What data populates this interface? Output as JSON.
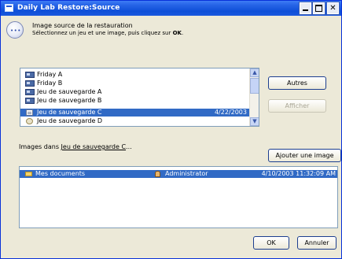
{
  "window": {
    "title": "Daily Lab Restore:Source"
  },
  "header": {
    "title": "Image source de la restauration",
    "subtitle_prefix": "Sélectionnez un jeu et une image, puis cliquez sur ",
    "subtitle_ok": "OK",
    "subtitle_suffix": "."
  },
  "source_list": {
    "items": [
      {
        "label": "Friday A",
        "date": "",
        "icon": "backup-set-icon",
        "selected": false
      },
      {
        "label": "Friday B",
        "date": "",
        "icon": "backup-set-icon",
        "selected": false
      },
      {
        "label": "Jeu de sauvegarde A",
        "date": "",
        "icon": "backup-set-icon",
        "selected": false
      },
      {
        "label": "Jeu de sauvegarde B",
        "date": "",
        "icon": "backup-set-icon",
        "selected": false
      },
      {
        "label": "Jeu de sauvegarde C",
        "date": "4/22/2003",
        "icon": "catalog-icon",
        "selected": true
      },
      {
        "label": "Jeu de sauvegarde D",
        "date": "",
        "icon": "tape-icon",
        "selected": false
      }
    ]
  },
  "buttons": {
    "autres": "Autres",
    "afficher": "Afficher",
    "ajouter": "Ajouter une image",
    "ok": "OK",
    "annuler": "Annuler"
  },
  "images": {
    "label_prefix": "Images dans ",
    "label_link": "Jeu de sauvegarde C",
    "label_suffix": "...",
    "rows": [
      {
        "name": "Mes documents",
        "owner": "Administrator",
        "timestamp": "4/10/2003 11:32:09 AM"
      }
    ]
  },
  "colors": {
    "titlebar": "#0e4fd8",
    "selection": "#316ac5",
    "dialog_bg": "#ece9d8"
  }
}
